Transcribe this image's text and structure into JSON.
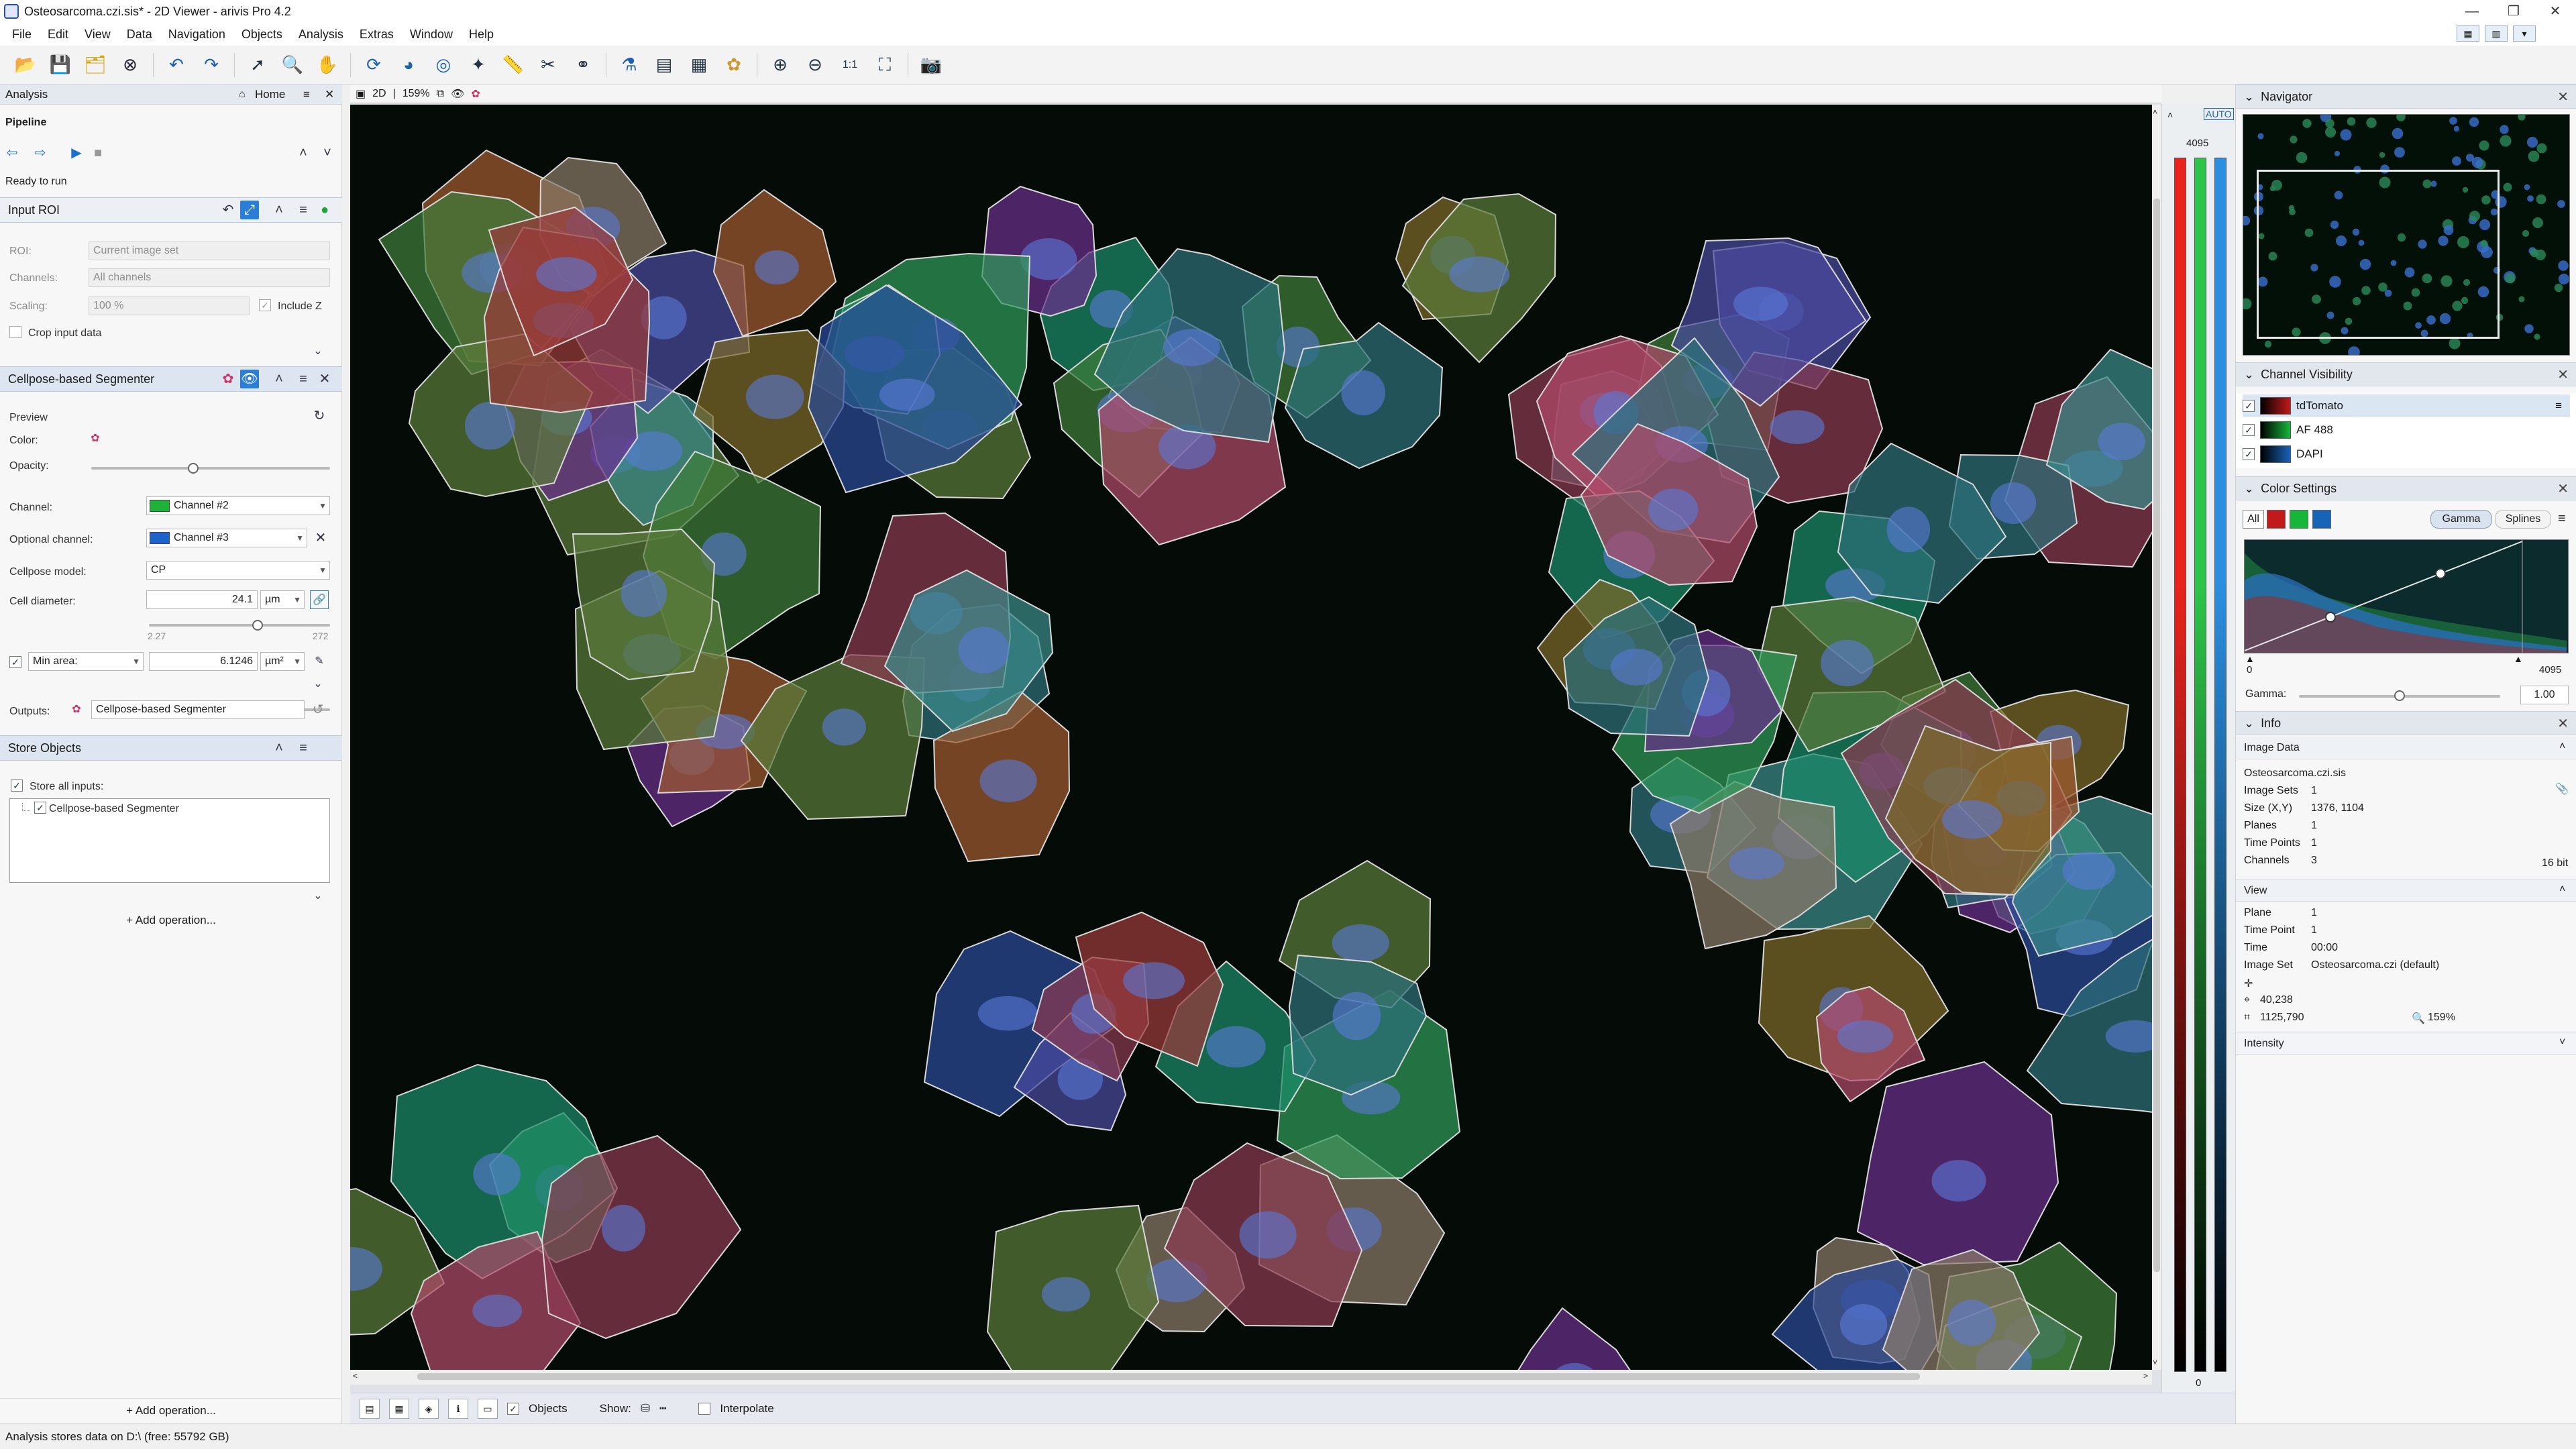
{
  "window": {
    "title": "Osteosarcoma.czi.sis* - 2D Viewer - arivis Pro 4.2",
    "controls": [
      "—",
      "❐",
      "✕"
    ]
  },
  "menu": [
    "File",
    "Edit",
    "View",
    "Data",
    "Navigation",
    "Objects",
    "Analysis",
    "Extras",
    "Window",
    "Help"
  ],
  "toolbar_icons": [
    "open-file",
    "save",
    "save-all",
    "close",
    "undo",
    "redo",
    "select",
    "zoom",
    "pan",
    "rotate",
    "paint",
    "lasso",
    "measure",
    "pen",
    "magic",
    "split",
    "lab",
    "export",
    "table",
    "color-wheel",
    "zoom-in",
    "zoom-out",
    "zoom-fit",
    "zoom-all",
    "screenshot"
  ],
  "analysis": {
    "panel_title": "Analysis",
    "home_label": "Home",
    "pipeline_label": "Pipeline",
    "status": "Ready to run",
    "input_roi": {
      "title": "Input ROI",
      "roi_label": "ROI:",
      "roi_value": "Current image set",
      "channels_label": "Channels:",
      "channels_value": "All channels",
      "scaling_label": "Scaling:",
      "scaling_value": "100 %",
      "include_z": "Include Z",
      "crop_label": "Crop input data"
    },
    "segmenter": {
      "title": "Cellpose-based Segmenter",
      "preview_label": "Preview",
      "color_label": "Color:",
      "opacity_label": "Opacity:",
      "channel_label": "Channel:",
      "channel_value": "Channel #2",
      "channel_color": "#1db33a",
      "optional_label": "Optional channel:",
      "optional_value": "Channel #3",
      "optional_color": "#1e63c9",
      "model_label": "Cellpose model:",
      "model_value": "CP",
      "diameter_label": "Cell diameter:",
      "diameter_value": "24.1",
      "diameter_unit": "µm",
      "diameter_min": "2.27",
      "diameter_max": "272",
      "min_area_label": "Min area:",
      "min_area_value": "6.1246",
      "min_area_unit": "µm²",
      "outputs_label": "Outputs:",
      "outputs_value": "Cellpose-based Segmenter"
    },
    "store": {
      "title": "Store Objects",
      "store_all": "Store all inputs:",
      "item": "Cellpose-based Segmenter"
    },
    "add_operation": "Add operation..."
  },
  "viewer": {
    "mode": "2D",
    "zoom": "159%",
    "lut_auto": "AUTO",
    "lut_max": "4095",
    "lut_min": "0",
    "lut_colors": [
      "#e8241e",
      "#2ec44a",
      "#2a8fe0"
    ]
  },
  "bottom_bar": {
    "objects_label": "Objects",
    "show_label": "Show:",
    "interpolate_label": "Interpolate"
  },
  "navigator": {
    "title": "Navigator"
  },
  "channel_visibility": {
    "title": "Channel Visibility",
    "channels": [
      {
        "name": "tdTomato",
        "color": "#c21a1a"
      },
      {
        "name": "AF 488",
        "color": "#16b63a"
      },
      {
        "name": "DAPI",
        "color": "#1763b8"
      }
    ]
  },
  "color_settings": {
    "title": "Color Settings",
    "all_label": "All",
    "gamma_tab": "Gamma",
    "splines_tab": "Splines",
    "min": "0",
    "max": "4095",
    "gamma_label": "Gamma:",
    "gamma_value": "1.00"
  },
  "info": {
    "title": "Info",
    "image_data_title": "Image Data",
    "filename": "Osteosarcoma.czi.sis",
    "rows": [
      {
        "k": "Image Sets",
        "v": "1"
      },
      {
        "k": "Size (X,Y)",
        "v": "1376, 1104"
      },
      {
        "k": "Planes",
        "v": "1"
      },
      {
        "k": "Time Points",
        "v": "1"
      },
      {
        "k": "Channels",
        "v": "3"
      }
    ],
    "bit_depth": "16 bit",
    "view_title": "View",
    "view_rows": [
      {
        "k": "Plane",
        "v": "1"
      },
      {
        "k": "Time Point",
        "v": "1"
      },
      {
        "k": "Time",
        "v": "00:00"
      },
      {
        "k": "Image Set",
        "v": "Osteosarcoma.czi (default)"
      }
    ],
    "coord1": "40,238",
    "coord2": "1125,790",
    "zoom": "159%",
    "intensity_title": "Intensity"
  },
  "status_bar": "Analysis stores data on D:\\ (free: 55792 GB)"
}
